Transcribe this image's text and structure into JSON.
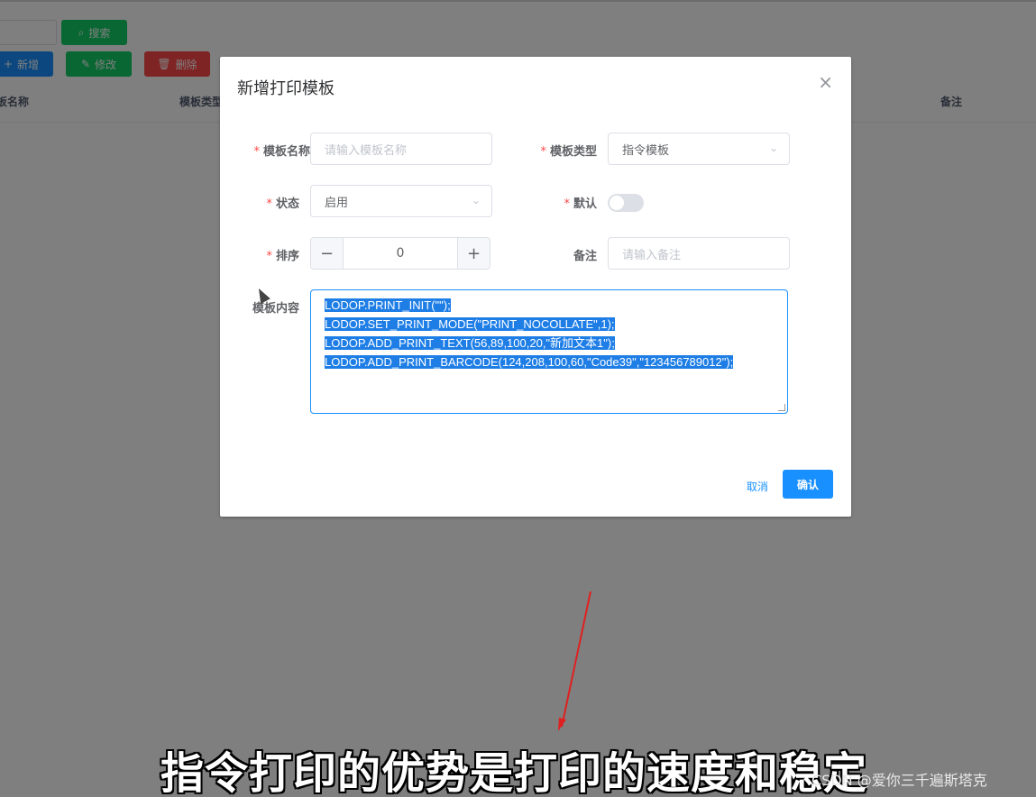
{
  "toolbar": {
    "search_label": "搜索",
    "add_label": "新增",
    "edit_label": "修改",
    "delete_label": "删除"
  },
  "table": {
    "columns": [
      "板名称",
      "模板类型",
      "备注"
    ]
  },
  "dialog": {
    "title": "新增打印模板",
    "close": "×",
    "fields": {
      "name": {
        "label": "模板名称",
        "placeholder": "请输入模板名称"
      },
      "type": {
        "label": "模板类型",
        "value": "指令模板"
      },
      "status": {
        "label": "状态",
        "value": "启用"
      },
      "default": {
        "label": "默认",
        "checked": false
      },
      "sort": {
        "label": "排序",
        "value": "0",
        "minus": "−",
        "plus": "+"
      },
      "remark": {
        "label": "备注",
        "placeholder": "请输入备注"
      },
      "content": {
        "label": "模板内容",
        "lines": [
          "LODOP.PRINT_INIT(\"\");",
          "LODOP.SET_PRINT_MODE(\"PRINT_NOCOLLATE\",1);",
          "LODOP.ADD_PRINT_TEXT(56,89,100,20,\"新加文本1\");",
          "LODOP.ADD_PRINT_BARCODE(124,208,100,60,\"Code39\",\"123456789012\");"
        ]
      }
    },
    "cancel_label": "取消",
    "confirm_label": "确认"
  },
  "overlay": {
    "subtitle": "指令打印的优势是打印的速度和稳定",
    "watermark": "CSDN @爱你三千遍斯塔克"
  },
  "colors": {
    "primary": "#1890ff",
    "success": "#13ce66",
    "danger": "#ff4949"
  }
}
